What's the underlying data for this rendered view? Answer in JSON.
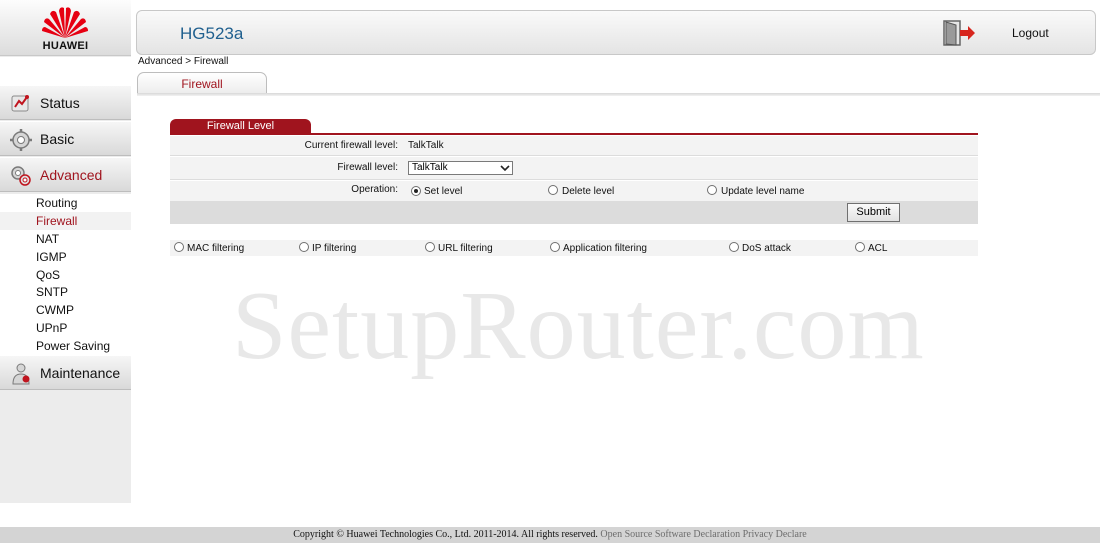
{
  "brand": {
    "logo_text": "HUAWEI",
    "color": "#e60012"
  },
  "header": {
    "model": "HG523a",
    "logout_label": "Logout",
    "logout_icon": "door-exit-icon"
  },
  "breadcrumb": "Advanced > Firewall",
  "tab": {
    "label": "Firewall"
  },
  "sidebar": {
    "items": [
      {
        "label": "Status",
        "icon": "status-icon"
      },
      {
        "label": "Basic",
        "icon": "gear-icon"
      },
      {
        "label": "Advanced",
        "icon": "advanced-icon"
      },
      {
        "label": "Maintenance",
        "icon": "maintenance-icon"
      }
    ],
    "advanced_sub": [
      "Routing",
      "Firewall",
      "NAT",
      "IGMP",
      "QoS",
      "SNTP",
      "CWMP",
      "UPnP",
      "Power Saving"
    ],
    "active_item": "Advanced",
    "active_sub": "Firewall"
  },
  "panel": {
    "title": "Firewall Level",
    "current_label": "Current firewall level:",
    "current_value": "TalkTalk",
    "level_label": "Firewall level:",
    "level_selected": "TalkTalk",
    "operation_label": "Operation:",
    "operations": [
      {
        "label": "Set level",
        "selected": true
      },
      {
        "label": "Delete level",
        "selected": false
      },
      {
        "label": "Update level name",
        "selected": false
      }
    ],
    "submit_label": "Submit"
  },
  "filters": [
    {
      "label": "MAC filtering",
      "selected": false
    },
    {
      "label": "IP filtering",
      "selected": false
    },
    {
      "label": "URL filtering",
      "selected": false
    },
    {
      "label": "Application filtering",
      "selected": false
    },
    {
      "label": "DoS attack",
      "selected": false
    },
    {
      "label": "ACL",
      "selected": false
    }
  ],
  "watermark": "SetupRouter.com",
  "footer": {
    "copyright": "Copyright © Huawei Technologies Co., Ltd. 2011-2014. All rights reserved.",
    "link1": "Open Source Software Declaration",
    "link2": "Privacy Declare"
  },
  "colors": {
    "accent": "#a0141e",
    "model_text": "#1f5f8e"
  }
}
